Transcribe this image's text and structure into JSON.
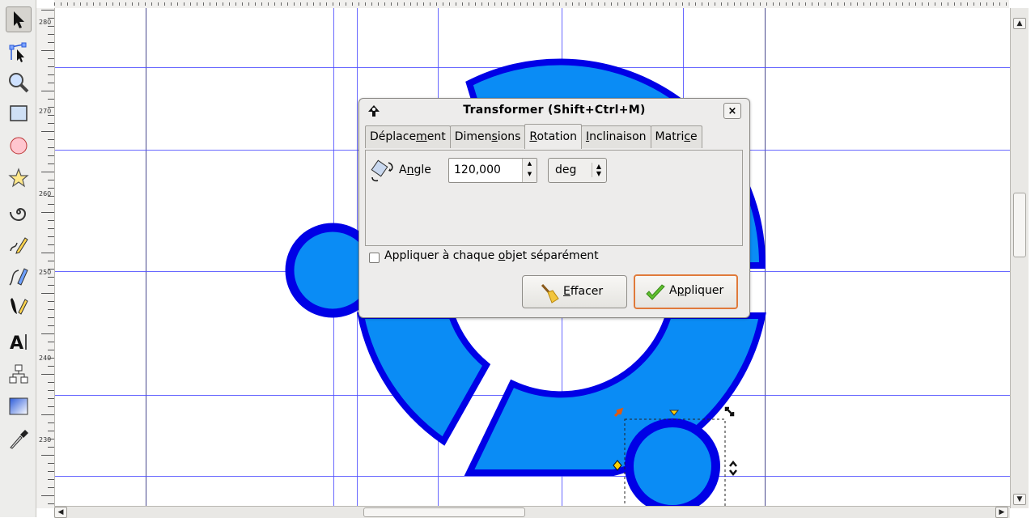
{
  "dialog": {
    "title": "Transformer (Shift+Ctrl+M)",
    "close_glyph": "×",
    "tabs": [
      {
        "pre": "Déplace",
        "mnemonic": "m",
        "post": "ent"
      },
      {
        "pre": "Dimen",
        "mnemonic": "s",
        "post": "ions"
      },
      {
        "pre": "",
        "mnemonic": "R",
        "post": "otation"
      },
      {
        "pre": "",
        "mnemonic": "I",
        "post": "nclinaison"
      },
      {
        "pre": "Matri",
        "mnemonic": "c",
        "post": "e"
      }
    ],
    "active_tab": "Rotation",
    "angle": {
      "label_pre": "A",
      "label_mnemonic": "n",
      "label_post": "gle",
      "value": "120,000",
      "unit": "deg"
    },
    "apply_each": {
      "label_pre": "Appliquer à chaque ",
      "label_mnemonic": "o",
      "label_post": "bjet séparément",
      "checked": false
    },
    "buttons": {
      "clear_mnemonic": "E",
      "clear_rest": "ffacer",
      "apply_pre": "A",
      "apply_mnemonic": "p",
      "apply_post": "pliquer"
    }
  },
  "ruler": {
    "labels": [
      "280",
      "270",
      "260",
      "250",
      "240",
      "230"
    ]
  },
  "toolbox": {
    "tools": [
      "selector-tool",
      "node-tool",
      "zoom-tool",
      "rectangle-tool",
      "ellipse-tool",
      "star-tool",
      "spiral-tool",
      "pencil-tool",
      "pen-tool",
      "calligraphy-tool",
      "text-tool",
      "connector-tool",
      "gradient-tool",
      "dropper-tool"
    ],
    "active": "selector-tool"
  },
  "colors": {
    "shape_fill": "#0a8cf5",
    "shape_stroke": "#0000e6",
    "guide": "#4d4dff",
    "apply_focus": "#e07a3a"
  }
}
